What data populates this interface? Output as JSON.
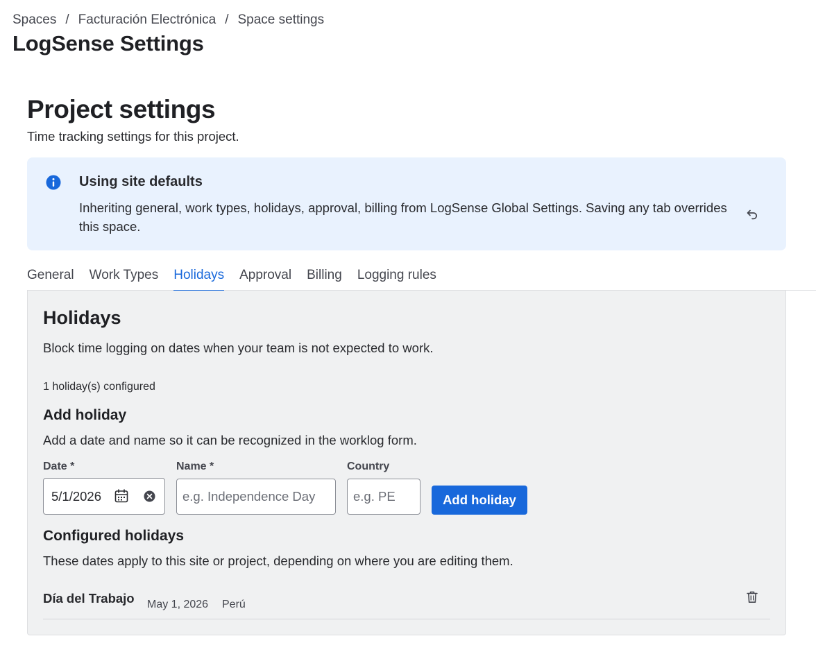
{
  "breadcrumb": {
    "items": [
      "Spaces",
      "Facturación Electrónica",
      "Space settings"
    ],
    "separator": "/"
  },
  "page_title": "LogSense Settings",
  "section": {
    "title": "Project settings",
    "subtitle": "Time tracking settings for this project."
  },
  "banner": {
    "title": "Using site defaults",
    "text": "Inheriting general, work types, holidays, approval, billing from LogSense Global Settings. Saving any tab overrides this space.",
    "icon": "info-icon",
    "action_icon": "undo-icon"
  },
  "tabs": [
    {
      "label": "General",
      "active": false
    },
    {
      "label": "Work Types",
      "active": false
    },
    {
      "label": "Holidays",
      "active": true
    },
    {
      "label": "Approval",
      "active": false
    },
    {
      "label": "Billing",
      "active": false
    },
    {
      "label": "Logging rules",
      "active": false
    }
  ],
  "holidays": {
    "title": "Holidays",
    "description": "Block time logging on dates when your team is not expected to work.",
    "count_text": "1 holiday(s) configured",
    "add": {
      "title": "Add holiday",
      "description": "Add a date and name so it can be recognized in the worklog form.",
      "date_label": "Date *",
      "date_value": "5/1/2026",
      "name_label": "Name *",
      "name_placeholder": "e.g. Independence Day",
      "name_value": "",
      "country_label": "Country",
      "country_placeholder": "e.g. PE",
      "country_value": "",
      "button_label": "Add holiday"
    },
    "configured": {
      "title": "Configured holidays",
      "description": "These dates apply to this site or project, depending on where you are editing them.",
      "items": [
        {
          "name": "Día del Trabajo",
          "date": "May 1, 2026",
          "country": "Perú"
        }
      ]
    }
  },
  "colors": {
    "accent": "#1868db",
    "banner_bg": "#e9f2fe",
    "panel_bg": "#f0f1f2",
    "text": "#292a2e"
  }
}
